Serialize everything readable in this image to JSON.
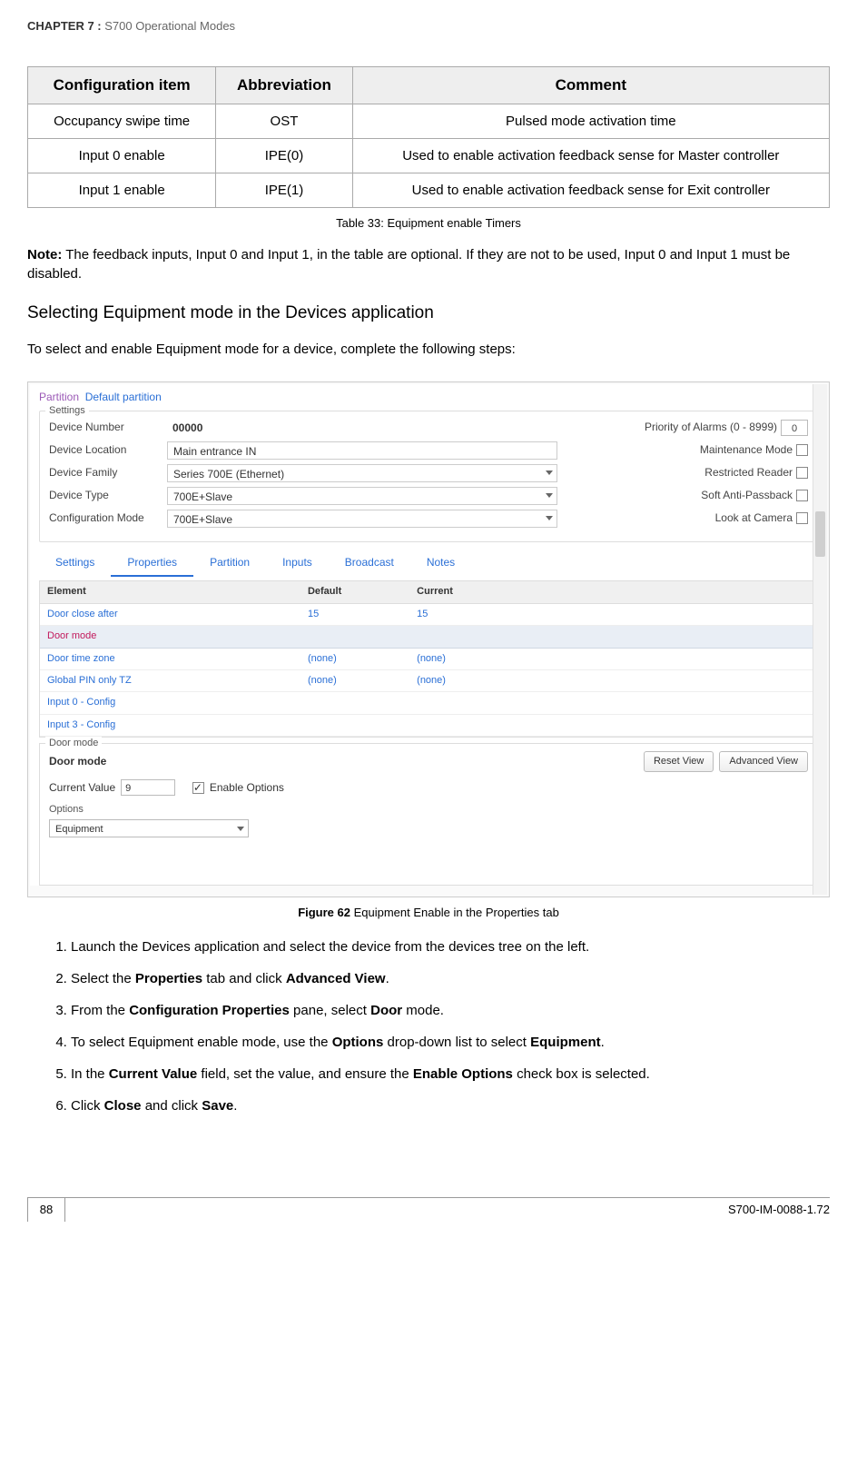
{
  "header": {
    "chapter_label": "CHAPTER  7 : ",
    "chapter_title": "S700 Operational Modes"
  },
  "table": {
    "headers": {
      "config": "Configuration item",
      "abbr": "Abbreviation",
      "comment": "Comment"
    },
    "rows": [
      {
        "config": "Occupancy swipe time",
        "abbr": "OST",
        "comment": "Pulsed mode activation time"
      },
      {
        "config": "Input 0 enable",
        "abbr": "IPE(0)",
        "comment": "Used to enable activation feedback sense for Master controller"
      },
      {
        "config": "Input 1 enable",
        "abbr": "IPE(1)",
        "comment": "Used to enable activation feedback sense for Exit controller"
      }
    ],
    "caption": "Table 33: Equipment enable Timers"
  },
  "note": {
    "label": "Note:",
    "text": " The feedback inputs, Input 0 and Input 1, in the table are optional. If they are not to be used, Input 0 and Input 1 must be disabled."
  },
  "section": {
    "heading": "Selecting Equipment mode in the Devices application",
    "intro": "To select and enable Equipment mode for a device, complete the following steps:"
  },
  "figure": {
    "partition_label": "Partition",
    "partition_value": "Default partition",
    "group_label": "Settings",
    "rows": {
      "device_number": {
        "label": "Device Number",
        "value": "00000"
      },
      "device_location": {
        "label": "Device Location",
        "value": "Main entrance IN"
      },
      "device_family": {
        "label": "Device Family",
        "value": "Series 700E (Ethernet)"
      },
      "device_type": {
        "label": "Device Type",
        "value": "700E+Slave"
      },
      "config_mode": {
        "label": "Configuration Mode",
        "value": "700E+Slave"
      }
    },
    "right": {
      "priority_label": "Priority of Alarms (0 - 8999)",
      "priority_value": "0",
      "maint_label": "Maintenance Mode",
      "restr_label": "Restricted Reader",
      "anti_label": "Soft Anti-Passback",
      "camera_label": "Look at Camera"
    },
    "tabs": [
      "Settings",
      "Properties",
      "Partition",
      "Inputs",
      "Broadcast",
      "Notes"
    ],
    "prop_headers": {
      "element": "Element",
      "def": "Default",
      "cur": "Current"
    },
    "prop_rows": [
      {
        "e": "Door close after",
        "d": "15",
        "c": "15"
      },
      {
        "e": "Door mode",
        "d": "",
        "c": ""
      },
      {
        "e": "Door time zone",
        "d": "(none)",
        "c": "(none)"
      },
      {
        "e": "Global PIN only TZ",
        "d": "(none)",
        "c": "(none)"
      },
      {
        "e": "Input 0 - Config",
        "d": "",
        "c": ""
      },
      {
        "e": "Input 3 - Config",
        "d": "",
        "c": ""
      }
    ],
    "below": {
      "group_label": "Door mode",
      "bold_label": "Door mode",
      "reset_btn": "Reset View",
      "adv_btn": "Advanced View",
      "curval_label": "Current Value",
      "curval": "9",
      "enable_label": "Enable Options",
      "options_label": "Options",
      "options_value": "Equipment"
    },
    "caption_bold": "Figure 62",
    "caption_rest": " Equipment Enable in the Properties tab"
  },
  "steps": [
    {
      "pre": "Launch the Devices application and select the device from the devices tree on the left."
    },
    {
      "pre": "Select the ",
      "b1": "Properties",
      "mid": " tab and click ",
      "b2": "Advanced View",
      "post": "."
    },
    {
      "pre": "From the ",
      "b1": "Configuration Properties",
      "mid": " pane, select ",
      "b2": "Door",
      "post": " mode."
    },
    {
      "pre": "To select Equipment enable mode, use the ",
      "b1": "Options",
      "mid": " drop-down list to select ",
      "b2": "Equipment",
      "post": "."
    },
    {
      "pre": "In the ",
      "b1": "Current Value",
      "mid": " field, set the value, and ensure the ",
      "b2": "Enable Options",
      "post": " check box is selected."
    },
    {
      "pre": "Click ",
      "b1": "Close",
      "mid": " and click ",
      "b2": "Save",
      "post": "."
    }
  ],
  "footer": {
    "page": "88",
    "docid": "S700-IM-0088-1.72"
  }
}
